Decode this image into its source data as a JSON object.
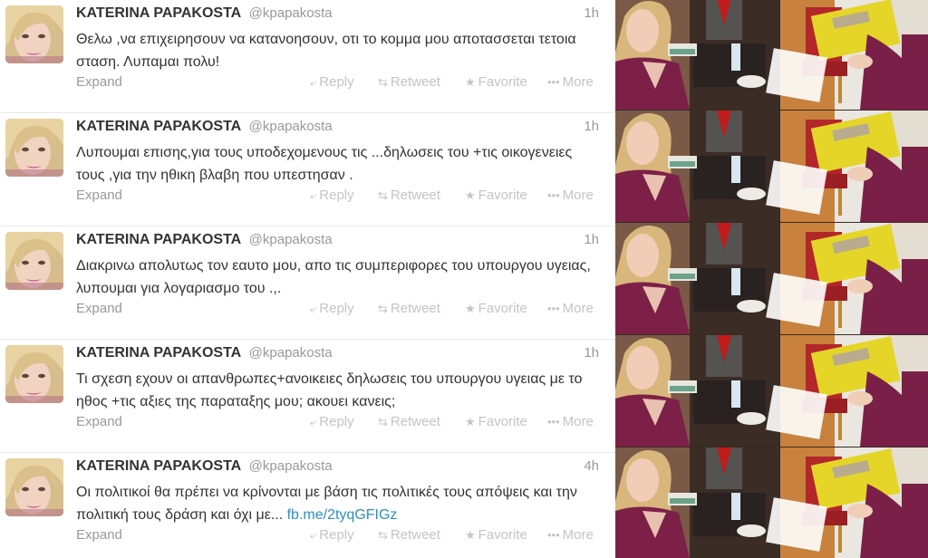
{
  "timeline": {
    "tweets": [
      {
        "name": "KATERINA PAPAKOSTA",
        "handle": "@kpapakosta",
        "time": "1h",
        "text": "Θελω ,να επιχειρησουν να κατανοησουν, οτι το κομμα μου αποτασσεται τετοια σταση. Λυπαμαι πολυ!",
        "link": ""
      },
      {
        "name": "KATERINA PAPAKOSTA",
        "handle": "@kpapakosta",
        "time": "1h",
        "text": "Λυπουμαι  επισης,για  τους υποδεχομενους τις ...δηλωσεις του +τις οικογενειες τους ,για την ηθικη βλαβη που υπεστησαν .",
        "link": ""
      },
      {
        "name": "KATERINA PAPAKOSTA",
        "handle": "@kpapakosta",
        "time": "1h",
        "text": "Διακρινω απολυτως τον εαυτο μου, απο τις συμπεριφορες του υπουργου υγειας, λυπουμαι  για λογαριασμο του .,.",
        "link": ""
      },
      {
        "name": "KATERINA PAPAKOSTA",
        "handle": "@kpapakosta",
        "time": "1h",
        "text": "Τι σχεση εχουν οι απανθρωπες+ανοικειες δηλωσεις του υπουργου υγειας με το ηθος +τις αξιες της παραταξης μου; ακουει κανεις;",
        "link": ""
      },
      {
        "name": "KATERINA PAPAKOSTA",
        "handle": "@kpapakosta",
        "time": "4h",
        "text": "Οι πολιτικοί θα πρέπει να κρίνονται με βάση τις πολιτικές τους απόψεις και την πολιτική τους δράση και όχι με... ",
        "link": "fb.me/2tyqGFIGz"
      }
    ],
    "actions": {
      "expand": "Expand",
      "reply": "Reply",
      "retweet": "Retweet",
      "favorite": "Favorite",
      "more": "More"
    },
    "icons": {
      "reply": "reply-icon",
      "retweet": "retweet-icon",
      "favorite": "star-icon",
      "more": "more-dots-icon"
    }
  },
  "colors": {
    "text": "#333333",
    "meta": "#999999",
    "action": "#c4c4c4",
    "link": "#2a8fc6"
  }
}
